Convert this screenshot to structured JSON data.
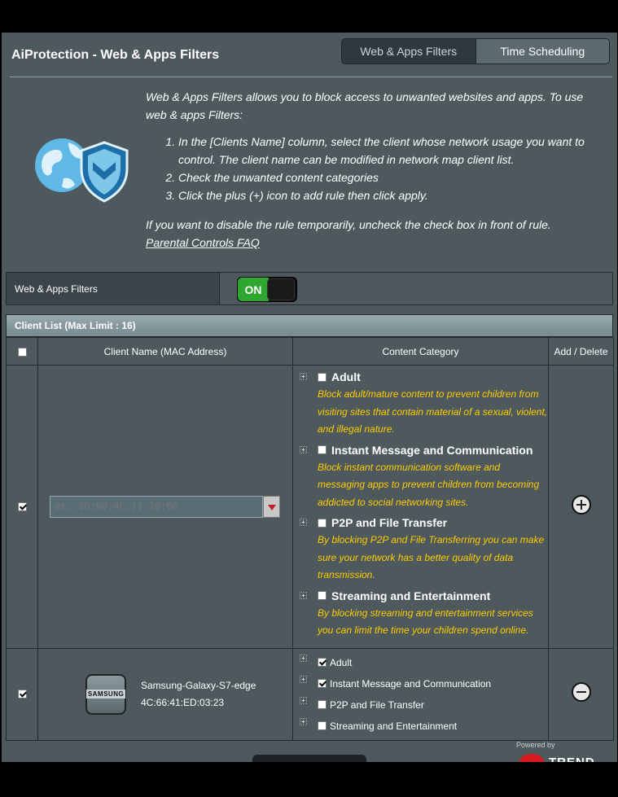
{
  "header": {
    "title": "AiProtection - Web & Apps Filters"
  },
  "tabs": [
    {
      "label": "Web & Apps Filters",
      "active": true
    },
    {
      "label": "Time Scheduling",
      "active": false
    }
  ],
  "intro": {
    "lead": "Web & Apps Filters allows you to block access to unwanted websites and apps. To use web & apps Filters:",
    "steps": [
      "In the [Clients Name] column, select the client whose network usage you want to control. The client name can be modified in network map client list.",
      "Check the unwanted content categories",
      "Click the plus (+) icon to add rule then click apply."
    ],
    "note": "If you want to disable the rule temporarily, uncheck the check box in front of rule.",
    "faq_link": "Parental Controls FAQ"
  },
  "toggle": {
    "label": "Web & Apps Filters",
    "state": "ON"
  },
  "client_list": {
    "title": "Client List (Max Limit : 16)",
    "columns": [
      "Client Name (MAC Address)",
      "Content Category",
      "Add / Delete"
    ],
    "new_rule": {
      "checked": true,
      "mac_placeholder": "ex: 00:90:4C:11:20:00",
      "categories": [
        {
          "name": "Adult",
          "desc": "Block adult/mature content to prevent children from visiting sites that contain material of a sexual, violent, and illegal nature."
        },
        {
          "name": "Instant Message and Communication",
          "desc": "Block instant communication software and messaging apps to prevent children from becoming addicted to social networking sites."
        },
        {
          "name": "P2P and File Transfer",
          "desc": "By blocking P2P and File Transferring you can make sure your network has a better quality of data transmission."
        },
        {
          "name": "Streaming and Entertainment",
          "desc": "By blocking streaming and entertainment services you can limit the time your children spend online."
        }
      ]
    },
    "rules": [
      {
        "checked": true,
        "brand": "SAMSUNG",
        "name": "Samsung-Galaxy-S7-edge",
        "mac": "4C:66:41:ED:03:23",
        "categories": [
          {
            "name": "Adult",
            "checked": true
          },
          {
            "name": "Instant Message and Communication",
            "checked": true
          },
          {
            "name": "P2P and File Transfer",
            "checked": false
          },
          {
            "name": "Streaming and Entertainment",
            "checked": false
          }
        ]
      }
    ]
  },
  "footer": {
    "powered_by": "Powered by",
    "brand": "TREND"
  },
  "colors": {
    "panel": "#4d595d",
    "accent_on": "#2fa62f",
    "desc_text": "#ffcc00"
  }
}
